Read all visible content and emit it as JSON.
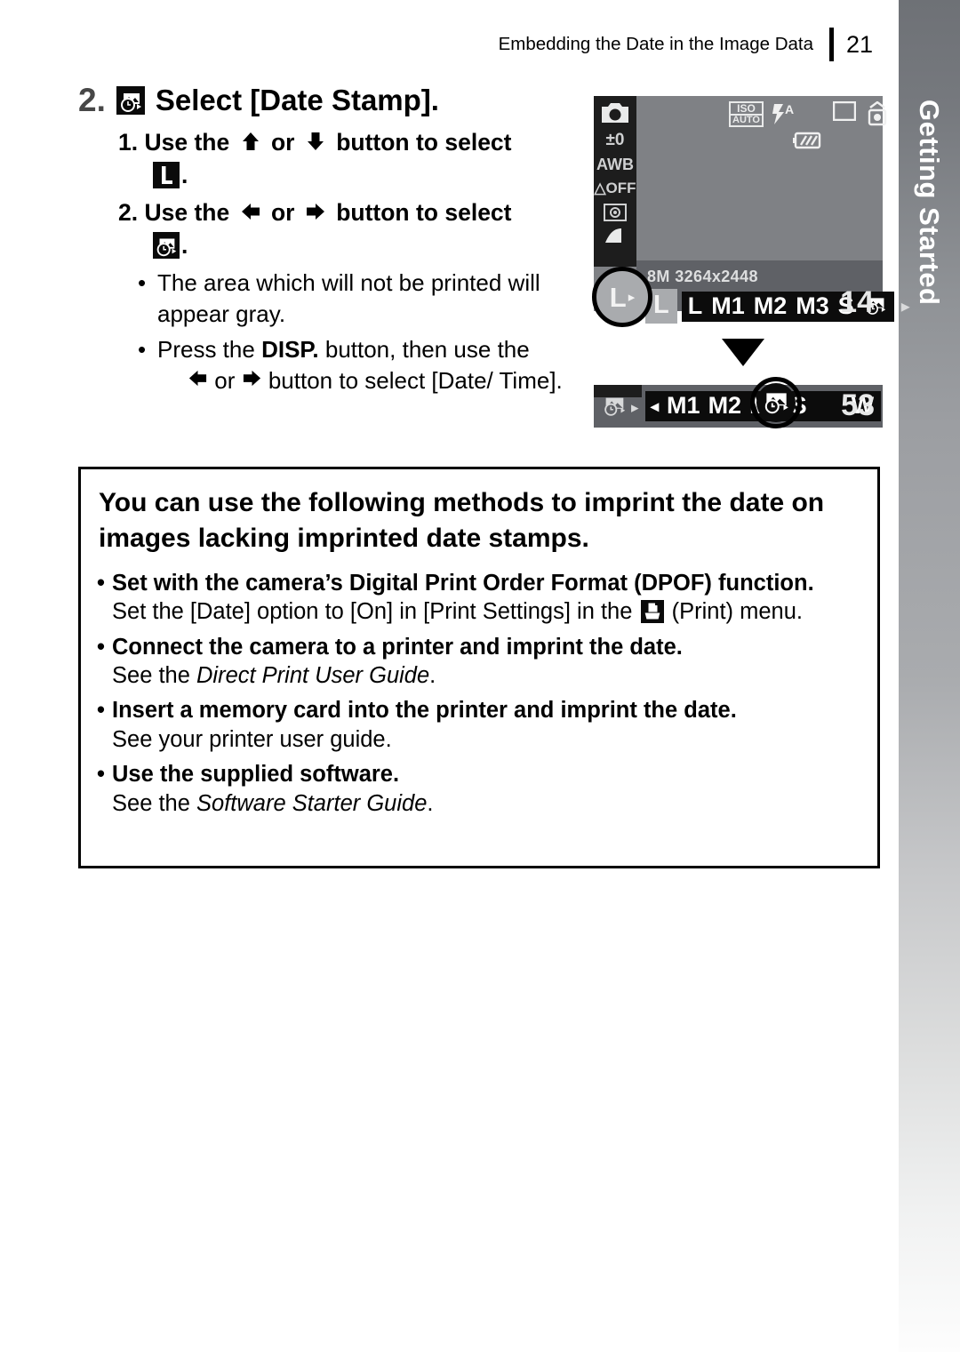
{
  "header": {
    "title": "Embedding the Date in the Image Data",
    "page_number": "21"
  },
  "chapter_tab": {
    "label": "Getting Started",
    "background_top_color": "#6e7176",
    "background_bottom_color": "#fdfdfd",
    "text_color": "#ffffff"
  },
  "step": {
    "number": "2.",
    "icon": "date-stamp-icon",
    "title": "Select [Date Stamp].",
    "substeps": [
      {
        "number": "1.",
        "text_before": "Use the",
        "arrow_up": "⬆",
        "or": "or",
        "arrow_down": "⬇",
        "text_after": "button to select",
        "icon": "image-size-large-icon",
        "icon_label": "L",
        "trailing": "."
      },
      {
        "number": "2.",
        "text_before": "Use the",
        "arrow_left": "⬅",
        "or": "or",
        "arrow_right": "➡",
        "text_after": "button to select",
        "icon": "date-stamp-icon",
        "trailing": "."
      }
    ],
    "bullets": [
      {
        "dot": "•",
        "text": "The area which will not be printed will appear gray."
      },
      {
        "dot": "•",
        "lead": "Press the",
        "emphasis": "DISP.",
        "mid": "button, then use the",
        "arrow_left": "⬅",
        "or": "or",
        "arrow_right": "➡",
        "tail": "button to select [Date/ Time]."
      }
    ]
  },
  "lcd_main": {
    "mode_icon": "camera-icon",
    "side_indicators": [
      {
        "name": "exposure-compensation-indicator",
        "label": "±0"
      },
      {
        "name": "white-balance-indicator",
        "label": "AWB"
      },
      {
        "name": "my-colors-off-indicator",
        "label": "OFF"
      },
      {
        "name": "metering-mode-icon",
        "label": ""
      },
      {
        "name": "image-quality-icon",
        "label": ""
      }
    ],
    "top_icons": [
      {
        "name": "iso-auto-icon",
        "label_top": "ISO",
        "label_bottom": "AUTO"
      },
      {
        "name": "flash-auto-icon",
        "label": "A"
      },
      {
        "name": "drive-mode-single-icon",
        "label": ""
      },
      {
        "name": "red-eye-icon",
        "label": ""
      },
      {
        "name": "battery-icon",
        "label": ""
      }
    ],
    "resolution_label": "8M  3264x2448",
    "selected_option": "L",
    "options": [
      "L",
      "M1",
      "M2",
      "M3",
      "S"
    ],
    "options_icon": "date-stamp-icon",
    "next_arrow": "▸",
    "shots_remaining": "14",
    "highlight": {
      "name": "highlight-circle-large-size",
      "label": "L",
      "arrow": "▸"
    }
  },
  "transition_arrow": "▼",
  "lcd_second": {
    "lead_icon": "date-stamp-icon",
    "lead_arrow": "▸",
    "prev_arrow": "◂",
    "options": [
      "M1",
      "M2",
      "M3",
      "S"
    ],
    "trailing_option": "W",
    "selected_icon": "date-stamp-icon",
    "shots_remaining": "53",
    "highlight": {
      "name": "highlight-circle-date-stamp"
    }
  },
  "callout": {
    "heading": "You can use the following methods to imprint the date on images lacking imprinted date stamps.",
    "items": [
      {
        "bullet": "•",
        "title": "Set with the camera’s Digital Print Order Format (DPOF) function.",
        "description_before": "Set the [Date] option to [On] in [Print Settings] in the",
        "icon": "print-icon",
        "description_after": "(Print) menu.",
        "italic": ""
      },
      {
        "bullet": "•",
        "title": "Connect the camera to a printer and imprint the date.",
        "description_before": "See the",
        "italic": "Direct Print User Guide",
        "description_after": "."
      },
      {
        "bullet": "•",
        "title": "Insert a memory card into the printer and imprint the date.",
        "description_before": "See your printer user guide.",
        "italic": "",
        "description_after": ""
      },
      {
        "bullet": "•",
        "title": "Use the supplied software.",
        "description_before": "See the",
        "italic": "Software Starter Guide",
        "description_after": "."
      }
    ]
  }
}
